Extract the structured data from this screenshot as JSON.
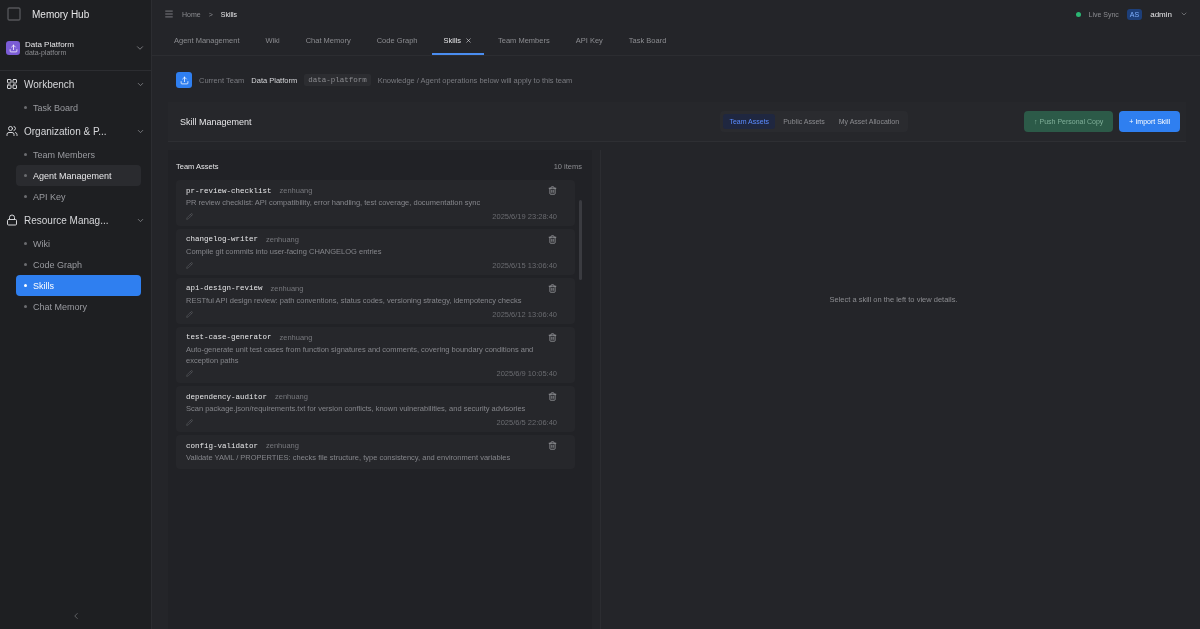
{
  "app": {
    "title": "Memory Hub"
  },
  "team_switcher": {
    "name": "Data Platform",
    "slug": "data-platform"
  },
  "sidebar": {
    "groups": [
      {
        "label": "Workbench",
        "expanded": true,
        "items": [
          {
            "label": "Task Board",
            "selected": false,
            "hovered": false
          }
        ]
      },
      {
        "label": "Organization & P...",
        "expanded": true,
        "items": [
          {
            "label": "Team Members",
            "selected": false,
            "hovered": false
          },
          {
            "label": "Agent Management",
            "selected": false,
            "hovered": true
          },
          {
            "label": "API Key",
            "selected": false,
            "hovered": false
          }
        ]
      },
      {
        "label": "Resource Manag...",
        "expanded": true,
        "items": [
          {
            "label": "Wiki",
            "selected": false,
            "hovered": false
          },
          {
            "label": "Code Graph",
            "selected": false,
            "hovered": false
          },
          {
            "label": "Skills",
            "selected": true,
            "hovered": false
          },
          {
            "label": "Chat Memory",
            "selected": false,
            "hovered": false
          }
        ]
      }
    ]
  },
  "breadcrumb": {
    "separator": ">",
    "items": [
      "Home",
      "Skills"
    ]
  },
  "top_bar": {
    "sync": "Live Sync",
    "avatar": "AS",
    "user": "admin"
  },
  "tabs": [
    {
      "label": "Agent Management",
      "selected": false
    },
    {
      "label": "Wiki",
      "selected": false
    },
    {
      "label": "Chat Memory",
      "selected": false
    },
    {
      "label": "Code Graph",
      "selected": false
    },
    {
      "label": "Skills",
      "selected": true
    },
    {
      "label": "Team Members",
      "selected": false
    },
    {
      "label": "API Key",
      "selected": false
    },
    {
      "label": "Task Board",
      "selected": false
    }
  ],
  "team_banner": {
    "label": "Current Team",
    "team": "Data Platform",
    "slug": "data-platform",
    "note": "Knowledge / Agent operations below will apply to this team"
  },
  "skill_management": {
    "title": "Skill Management",
    "segments": [
      {
        "label": "Team Assets",
        "selected": true
      },
      {
        "label": "Public Assets",
        "selected": false
      },
      {
        "label": "My Asset Allocation",
        "selected": false
      }
    ],
    "buttons": [
      {
        "label": "↑ Push Personal Copy",
        "kind": "secondary"
      },
      {
        "label": "+ Import Skill",
        "kind": "primary"
      }
    ]
  },
  "list": {
    "title": "Team Assets",
    "count": "10 items",
    "items": [
      {
        "name": "pr-review-checklist",
        "author": "zenhuang",
        "description": "PR review checklist: API compatibility, error handling, test coverage, documentation sync",
        "date": "2025/6/19 23:28:40"
      },
      {
        "name": "changelog-writer",
        "author": "zenhuang",
        "description": "Compile git commits into user-facing CHANGELOG entries",
        "date": "2025/6/15 13:06:40"
      },
      {
        "name": "api-design-review",
        "author": "zenhuang",
        "description": "RESTful API design review: path conventions, status codes, versioning strategy, idempotency checks",
        "date": "2025/6/12 13:06:40"
      },
      {
        "name": "test-case-generator",
        "author": "zenhuang",
        "description": "Auto-generate unit test cases from function signatures and comments, covering boundary conditions and exception paths",
        "date": "2025/6/9 10:05:40"
      },
      {
        "name": "dependency-auditor",
        "author": "zenhuang",
        "description": "Scan package.json/requirements.txt for version conflicts, known vulnerabilities, and security advisories",
        "date": "2025/6/5 22:06:40"
      },
      {
        "name": "config-validator",
        "author": "zenhuang",
        "description": "Validate YAML / PROPERTIES: checks file structure, type consistency, and environment variables"
      }
    ]
  },
  "detail": {
    "empty": "Select a skill on the left to view details."
  }
}
